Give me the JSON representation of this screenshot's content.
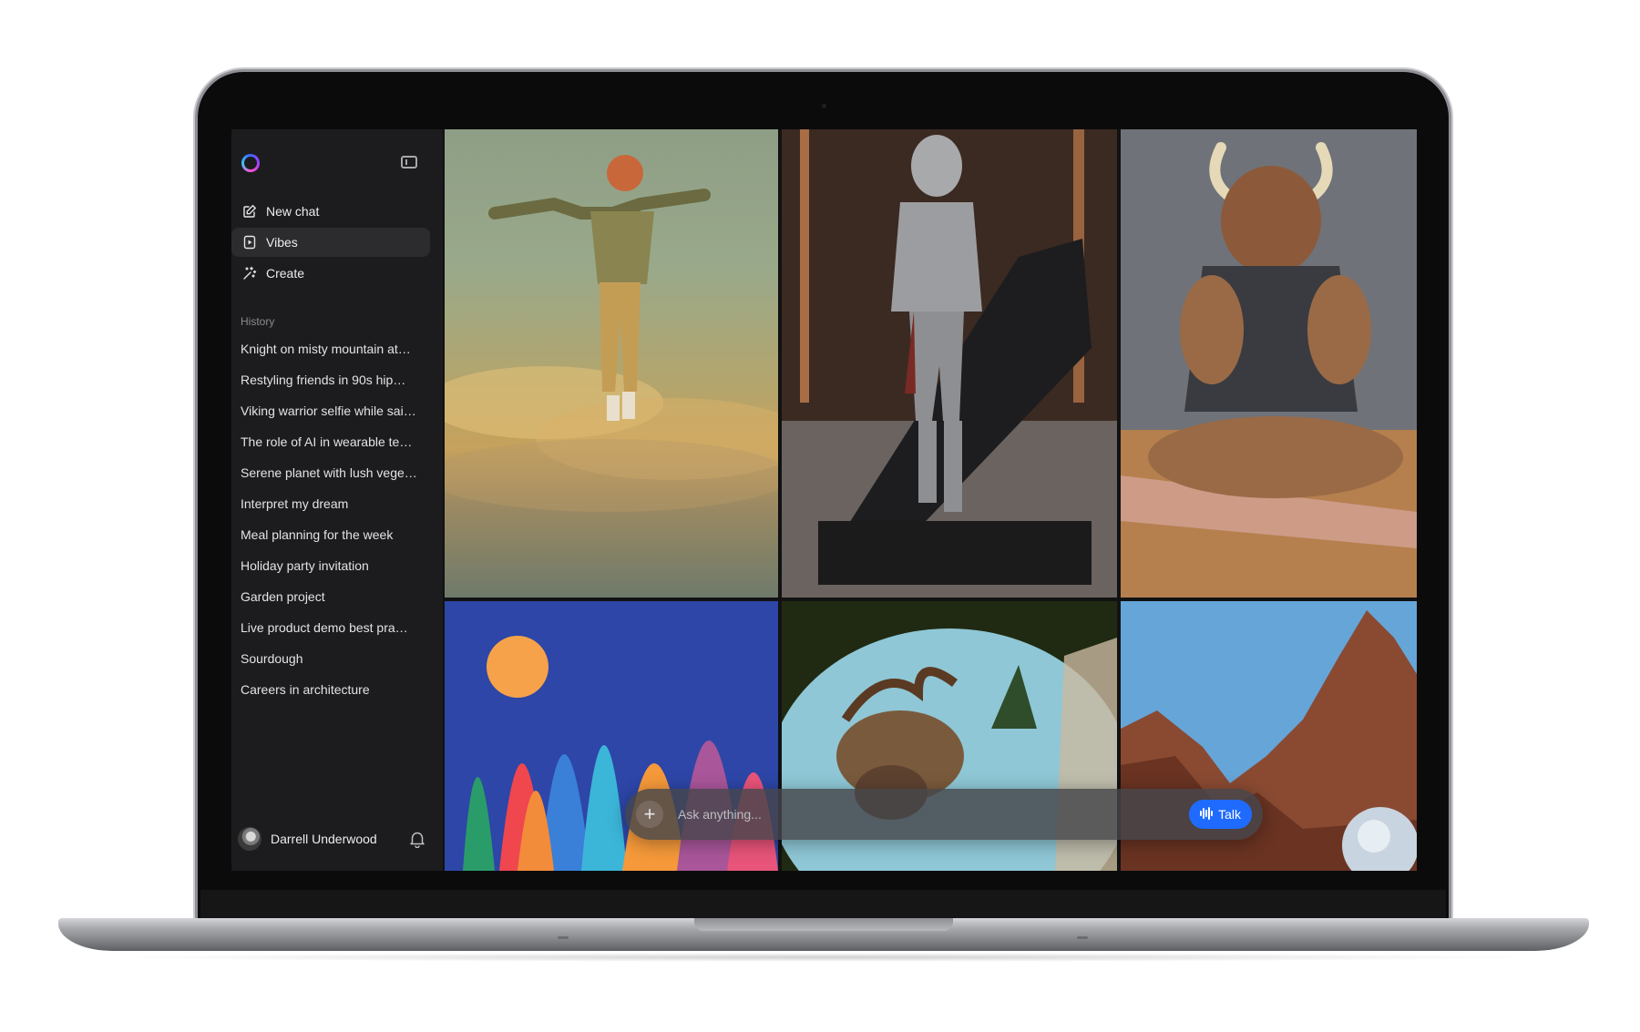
{
  "sidebar": {
    "nav": [
      {
        "label": "New chat",
        "icon": "edit-icon"
      },
      {
        "label": "Vibes",
        "icon": "video-icon"
      },
      {
        "label": "Create",
        "icon": "sparkle-wand-icon"
      }
    ],
    "history_label": "History",
    "history": [
      "Knight on misty mountain at…",
      "Restyling friends in 90s hip…",
      "Viking warrior selfie while sai…",
      "The role of AI in wearable te…",
      "Serene planet with lush vege…",
      "Interpret my dream",
      "Meal planning for the week",
      "Holiday party invitation",
      "Garden project",
      "Live product demo best pra…",
      "Sourdough",
      "Careers in architecture"
    ],
    "user_name": "Darrell Underwood"
  },
  "composer": {
    "placeholder": "Ask anything...",
    "talk_label": "Talk"
  },
  "colors": {
    "accent": "#1f6bff",
    "sidebar_bg": "#1c1c1e",
    "active_item_bg": "#2c2c2f"
  }
}
